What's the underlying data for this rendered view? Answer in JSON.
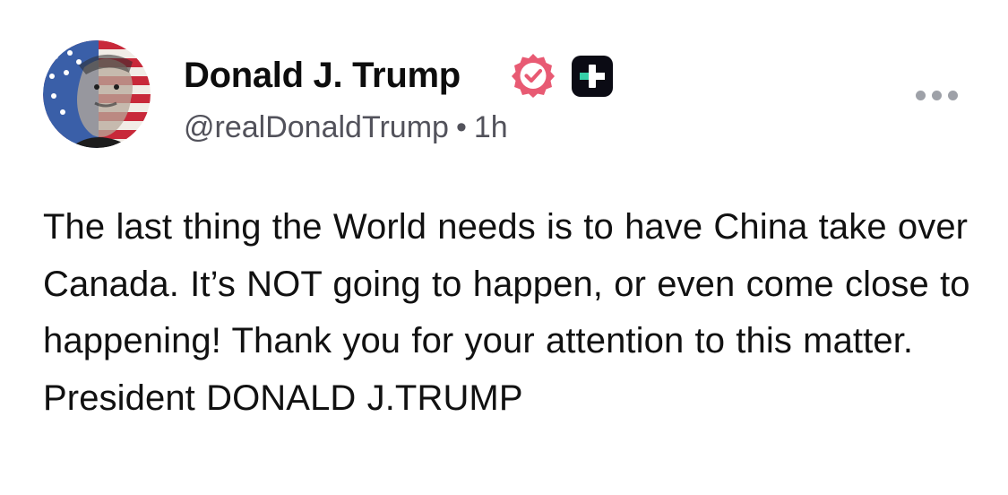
{
  "post": {
    "author_name": "Donald J. Trump",
    "handle": "@realDonaldTrump",
    "separator": "•",
    "timestamp": "1h",
    "verified_icon": "verified-check-icon",
    "badge_icon": "truth-social-plus-icon",
    "more_icon": "more-horizontal-icon",
    "body": "The last thing the World needs is to have China take over Canada. It’s NOT going to happen, or even come close to happening! Thank you for your attention to this matter. President DONALD J.TRUMP"
  },
  "colors": {
    "verified": "#e85a73",
    "badge_background": "#0b0b14",
    "badge_accent": "#35d0a8",
    "meta_text": "#52525b"
  }
}
